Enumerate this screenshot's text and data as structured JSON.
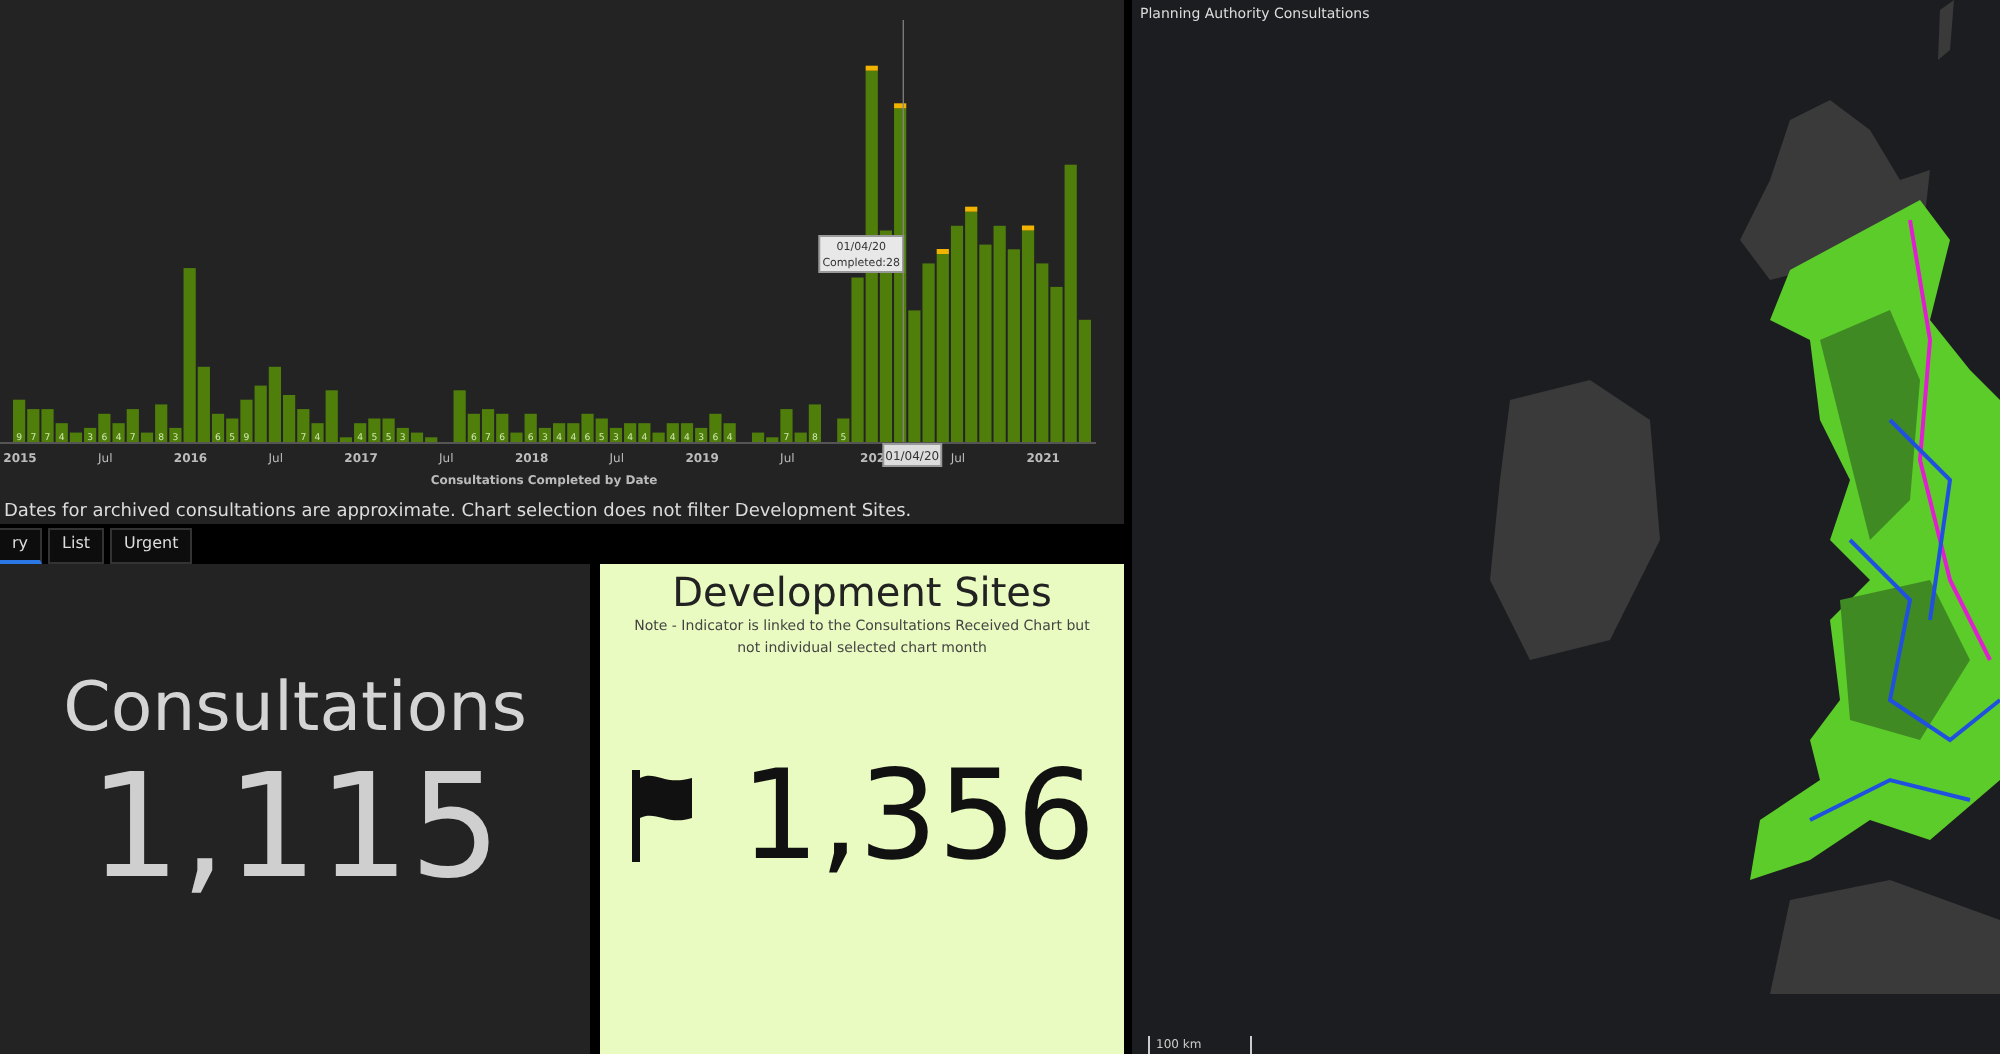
{
  "chart_panel": {
    "kind": "picture",
    "bar_label_runs": [
      [
        "9",
        "7",
        "7",
        "4"
      ],
      [
        "3",
        "6",
        "4",
        "7"
      ],
      [
        "8",
        "3"
      ],
      [
        "6",
        "5",
        "9"
      ],
      [
        "7",
        "4"
      ],
      [
        "4",
        "5",
        "5",
        "3"
      ],
      [
        "6",
        "7",
        "6"
      ],
      [
        "6",
        "3",
        "4",
        "4",
        "6",
        "5",
        "3",
        "4",
        "4"
      ],
      [
        "4",
        "4",
        "3",
        "6",
        "4"
      ],
      [
        "7"
      ],
      [
        "8"
      ],
      [
        "5"
      ]
    ],
    "x_labels": [
      "2015",
      "Jul",
      "2016",
      "Jul",
      "2017",
      "Jul",
      "2018",
      "Jul",
      "2019",
      "Jul",
      "202",
      "Jul",
      "2021"
    ],
    "x_title": "Consultations Completed by Date",
    "tooltip": [
      "01/04/20",
      "Completed:28"
    ],
    "hover_label": "01/04/20",
    "note": "Dates for archived consultations are approximate. Chart selection does not filter Development Sites."
  },
  "tabs": [
    {
      "label": "ry",
      "selected": true
    },
    {
      "label": "List",
      "selected": false
    },
    {
      "label": "Urgent",
      "selected": false
    }
  ],
  "indicator_left": {
    "title": "Consultations",
    "value": "1,115"
  },
  "indicator_right": {
    "title": "Development Sites",
    "note": "Note - Indicator is linked to the Consultations Received Chart but not individual selected chart month",
    "value": "1,356"
  },
  "map": {
    "title": "Planning Authority Consultations",
    "kind": "picture",
    "scale_bar": "100 km"
  }
}
